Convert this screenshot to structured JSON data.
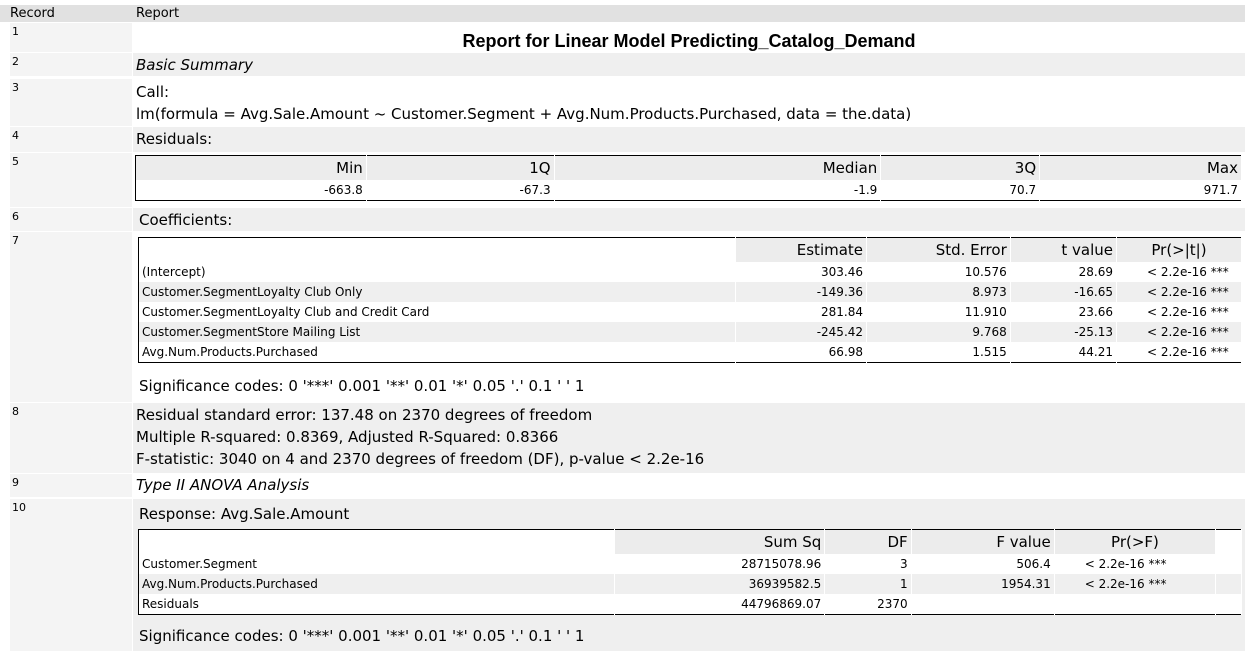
{
  "header": {
    "record_label": "Record",
    "report_label": "Report"
  },
  "records": [
    "1",
    "2",
    "3",
    "4",
    "5",
    "6",
    "7",
    "8",
    "9",
    "10"
  ],
  "report": {
    "title": "Report for Linear Model Predicting_Catalog_Demand",
    "basic_summary": "Basic Summary",
    "call_label": "Call:",
    "call_formula": "lm(formula = Avg.Sale.Amount ~ Customer.Segment + Avg.Num.Products.Purchased, data = the.data)",
    "residuals_label": "Residuals:",
    "residuals": {
      "headers": [
        "Min",
        "1Q",
        "Median",
        "3Q",
        "Max"
      ],
      "values": [
        "-663.8",
        "-67.3",
        "-1.9",
        "70.7",
        "971.7"
      ]
    },
    "coefficients_label": "Coefficients:",
    "coefficients": {
      "headers": [
        "",
        "Estimate",
        "Std. Error",
        "t value",
        "Pr(>|t|)"
      ],
      "rows": [
        [
          "(Intercept)",
          "303.46",
          "10.576",
          "28.69",
          "< 2.2e-16 ***"
        ],
        [
          "Customer.SegmentLoyalty Club Only",
          "-149.36",
          "8.973",
          "-16.65",
          "< 2.2e-16 ***"
        ],
        [
          "Customer.SegmentLoyalty Club and Credit Card",
          "281.84",
          "11.910",
          "23.66",
          "< 2.2e-16 ***"
        ],
        [
          "Customer.SegmentStore Mailing List",
          "-245.42",
          "9.768",
          "-25.13",
          "< 2.2e-16 ***"
        ],
        [
          "Avg.Num.Products.Purchased",
          "66.98",
          "1.515",
          "44.21",
          "< 2.2e-16 ***"
        ]
      ]
    },
    "significance_codes": "Significance codes: 0 '***' 0.001 '**' 0.01 '*' 0.05 '.' 0.1 ' ' 1",
    "fit": {
      "rse": "Residual standard error: 137.48 on 2370 degrees of freedom",
      "r2": "Multiple R-squared: 0.8369, Adjusted R-Squared: 0.8366",
      "fstat": "F-statistic: 3040 on 4 and 2370 degrees of freedom (DF), p-value < 2.2e-16"
    },
    "anova_title": "Type II ANOVA Analysis",
    "response_label": "Response: Avg.Sale.Amount",
    "anova": {
      "headers": [
        "",
        "Sum Sq",
        "DF",
        "F value",
        "Pr(>F)",
        ""
      ],
      "rows": [
        [
          "Customer.Segment",
          "28715078.96",
          "3",
          "506.4",
          "< 2.2e-16 ***"
        ],
        [
          "Avg.Num.Products.Purchased",
          "36939582.5",
          "1",
          "1954.31",
          "< 2.2e-16 ***"
        ],
        [
          "Residuals",
          "44796869.07",
          "2370",
          "",
          ""
        ]
      ]
    }
  }
}
